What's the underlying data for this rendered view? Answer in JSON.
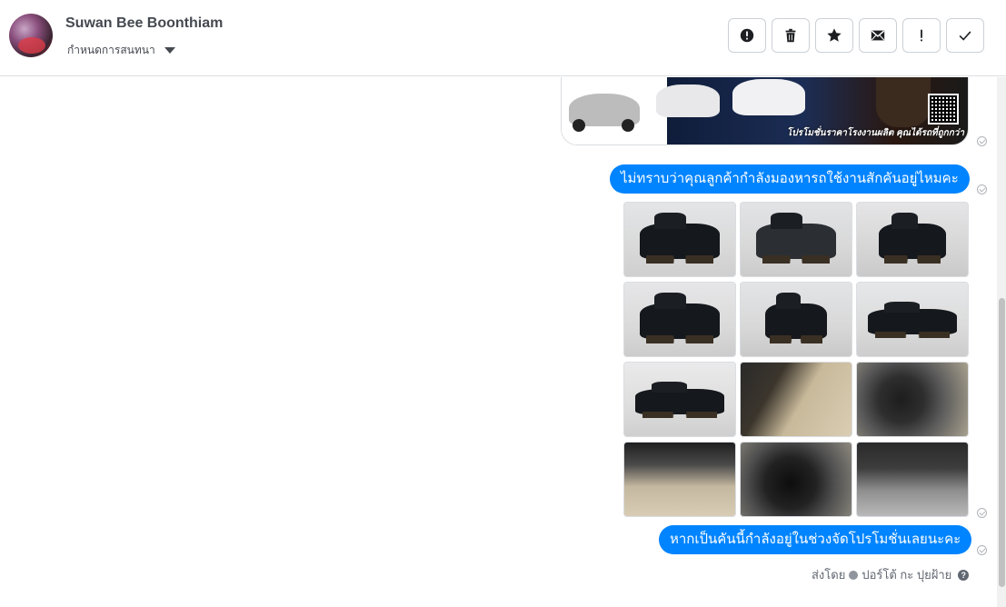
{
  "header": {
    "contact_name": "Suwan Bee Boonthiam",
    "assign_label": "กำหนดการสนทนา",
    "actions": [
      {
        "name": "spam-button",
        "icon": "alert-circle-icon"
      },
      {
        "name": "delete-button",
        "icon": "trash-icon"
      },
      {
        "name": "star-button",
        "icon": "star-icon"
      },
      {
        "name": "mark-unread-button",
        "icon": "envelope-icon"
      },
      {
        "name": "follow-up-button",
        "icon": "exclamation-icon"
      },
      {
        "name": "mark-done-button",
        "icon": "checkmark-icon"
      }
    ]
  },
  "thread": {
    "promo_caption": "โปรโมชั่นราคาโรงงานผลิต คุณได้รถที่ถูกกว่า",
    "message_1": "ไม่ทราบว่าคุณลูกค้ากำลังมองหารถใช้งานสักคันอยู่ไหมคะ",
    "photo_count": 12,
    "message_2": "หากเป็นคันนี้กำลังอยู่ในช่วงจัดโปรโมชั่นเลยนะคะ",
    "sent_by_label": "ส่งโดย",
    "sender_name": "ปอร์โต้ กะ ปุยฝ้าย",
    "help_glyph": "?"
  },
  "colors": {
    "bubble": "#0084ff",
    "border": "#dadde1",
    "icon": "#1c1e21"
  }
}
